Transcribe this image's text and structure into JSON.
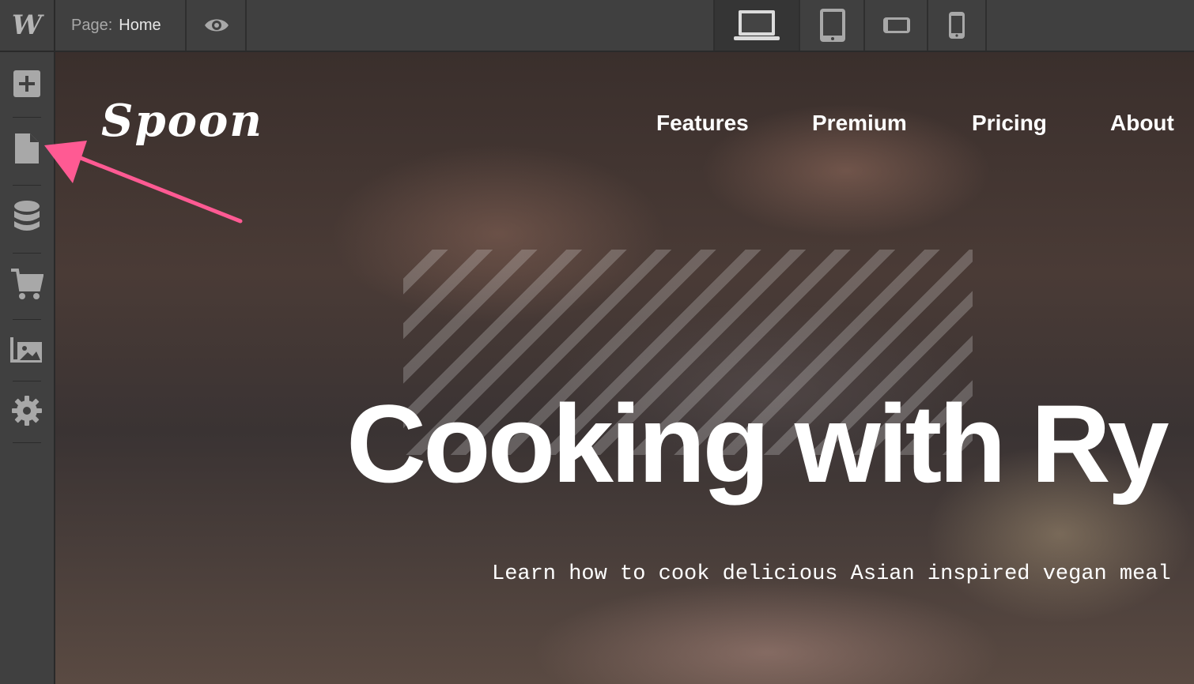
{
  "toolbar": {
    "logo": "W",
    "page_label": "Page:",
    "page_name": "Home",
    "preview_icon": "eye-icon",
    "devices": [
      "desktop-icon",
      "tablet-icon",
      "mobile-landscape-icon",
      "mobile-portrait-icon"
    ]
  },
  "sidebar": {
    "items": [
      "add-icon",
      "pages-icon",
      "cms-icon",
      "ecommerce-icon",
      "assets-icon",
      "settings-icon"
    ]
  },
  "site": {
    "logo": "Spoon",
    "nav": [
      "Features",
      "Premium",
      "Pricing",
      "About"
    ],
    "hero_title": "Cooking with Ry",
    "hero_subtitle": "Learn how to cook delicious Asian inspired vegan meal"
  },
  "annotation": {
    "arrow_color": "#ff5a93"
  }
}
